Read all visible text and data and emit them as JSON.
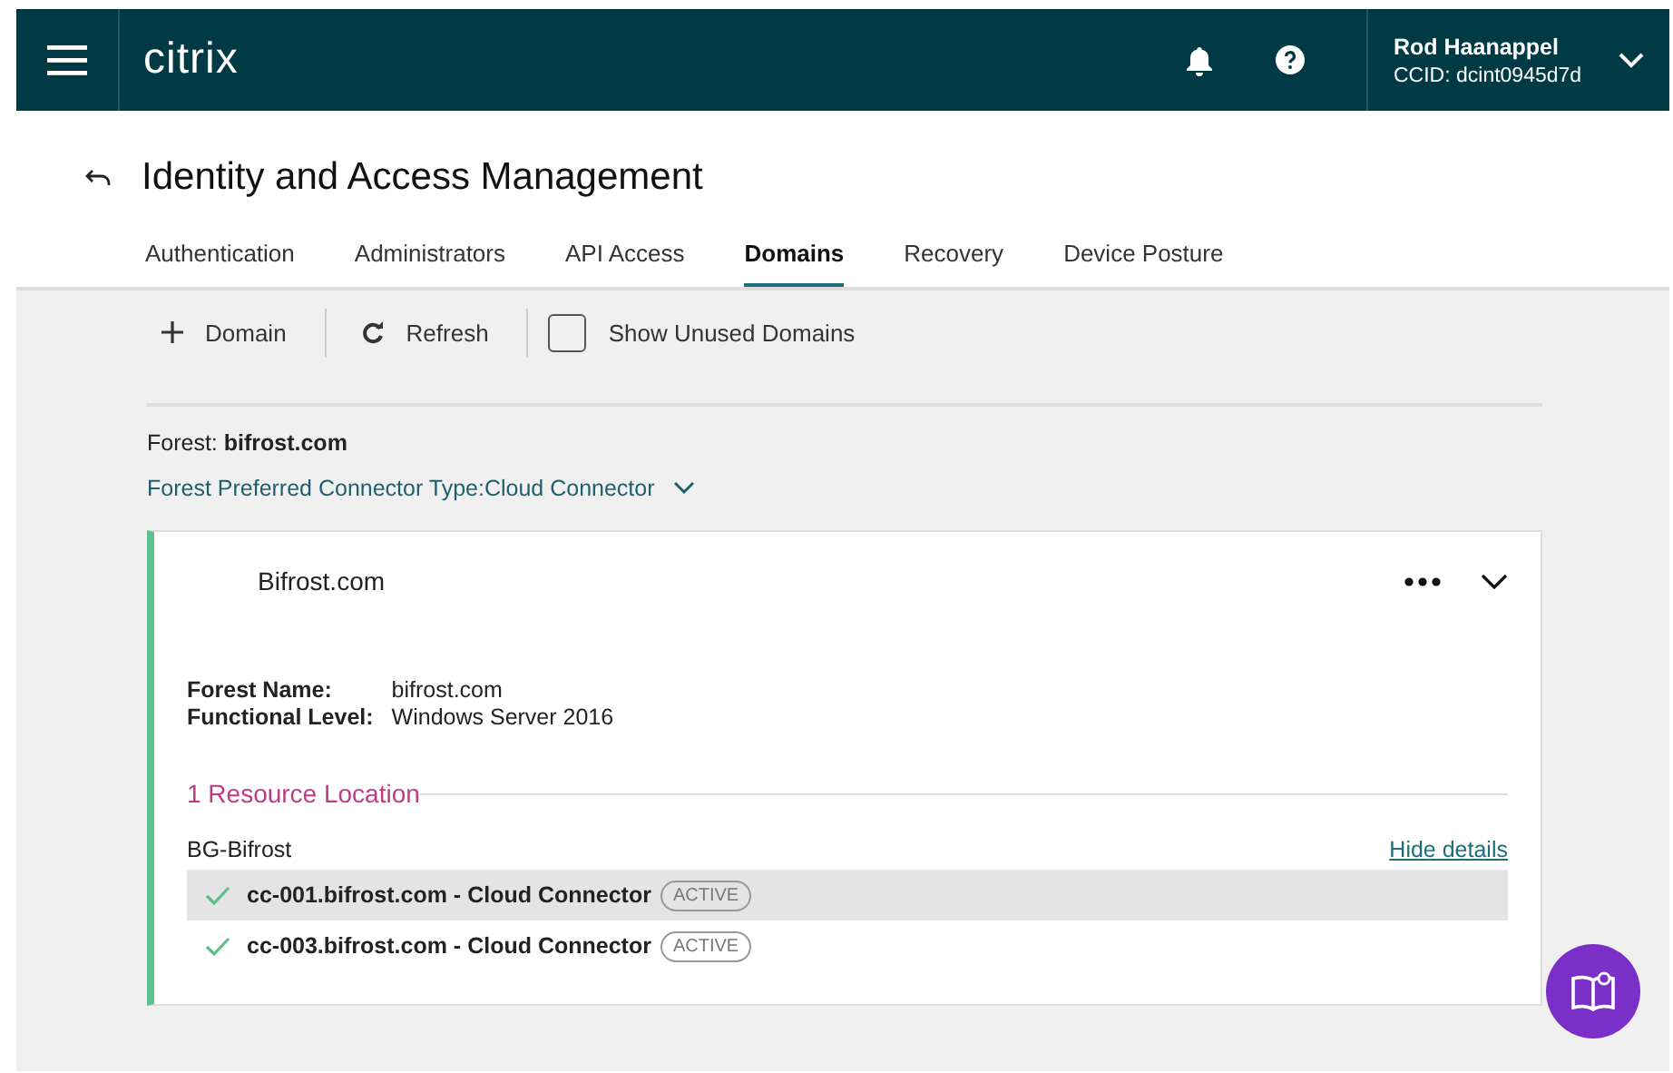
{
  "header": {
    "logo": "citrix",
    "user_name": "Rod Haanappel",
    "ccid": "CCID: dcint0945d7d"
  },
  "page": {
    "title": "Identity and Access Management"
  },
  "tabs": [
    {
      "label": "Authentication",
      "selected": false
    },
    {
      "label": "Administrators",
      "selected": false
    },
    {
      "label": "API Access",
      "selected": false
    },
    {
      "label": "Domains",
      "selected": true
    },
    {
      "label": "Recovery",
      "selected": false
    },
    {
      "label": "Device Posture",
      "selected": false
    }
  ],
  "toolbar": {
    "add_label": "Domain",
    "refresh_label": "Refresh",
    "show_unused": {
      "label": "Show Unused Domains",
      "checked": false
    }
  },
  "forest": {
    "label": "Forest:",
    "name": "bifrost.com",
    "connector_type": "Forest Preferred Connector Type:Cloud Connector"
  },
  "domain_card": {
    "name": "Bifrost.com",
    "details": [
      {
        "label": "Forest Name:",
        "value": "bifrost.com"
      },
      {
        "label": "Functional Level:",
        "value": "Windows Server 2016"
      }
    ],
    "resource_heading": "1 Resource Location",
    "location": "BG-Bifrost",
    "hide_details": "Hide details",
    "connectors": [
      {
        "name": "cc-001.bifrost.com - Cloud Connector",
        "status": "ACTIVE",
        "selected": true
      },
      {
        "name": "cc-003.bifrost.com - Cloud Connector",
        "status": "ACTIVE",
        "selected": false
      }
    ]
  }
}
